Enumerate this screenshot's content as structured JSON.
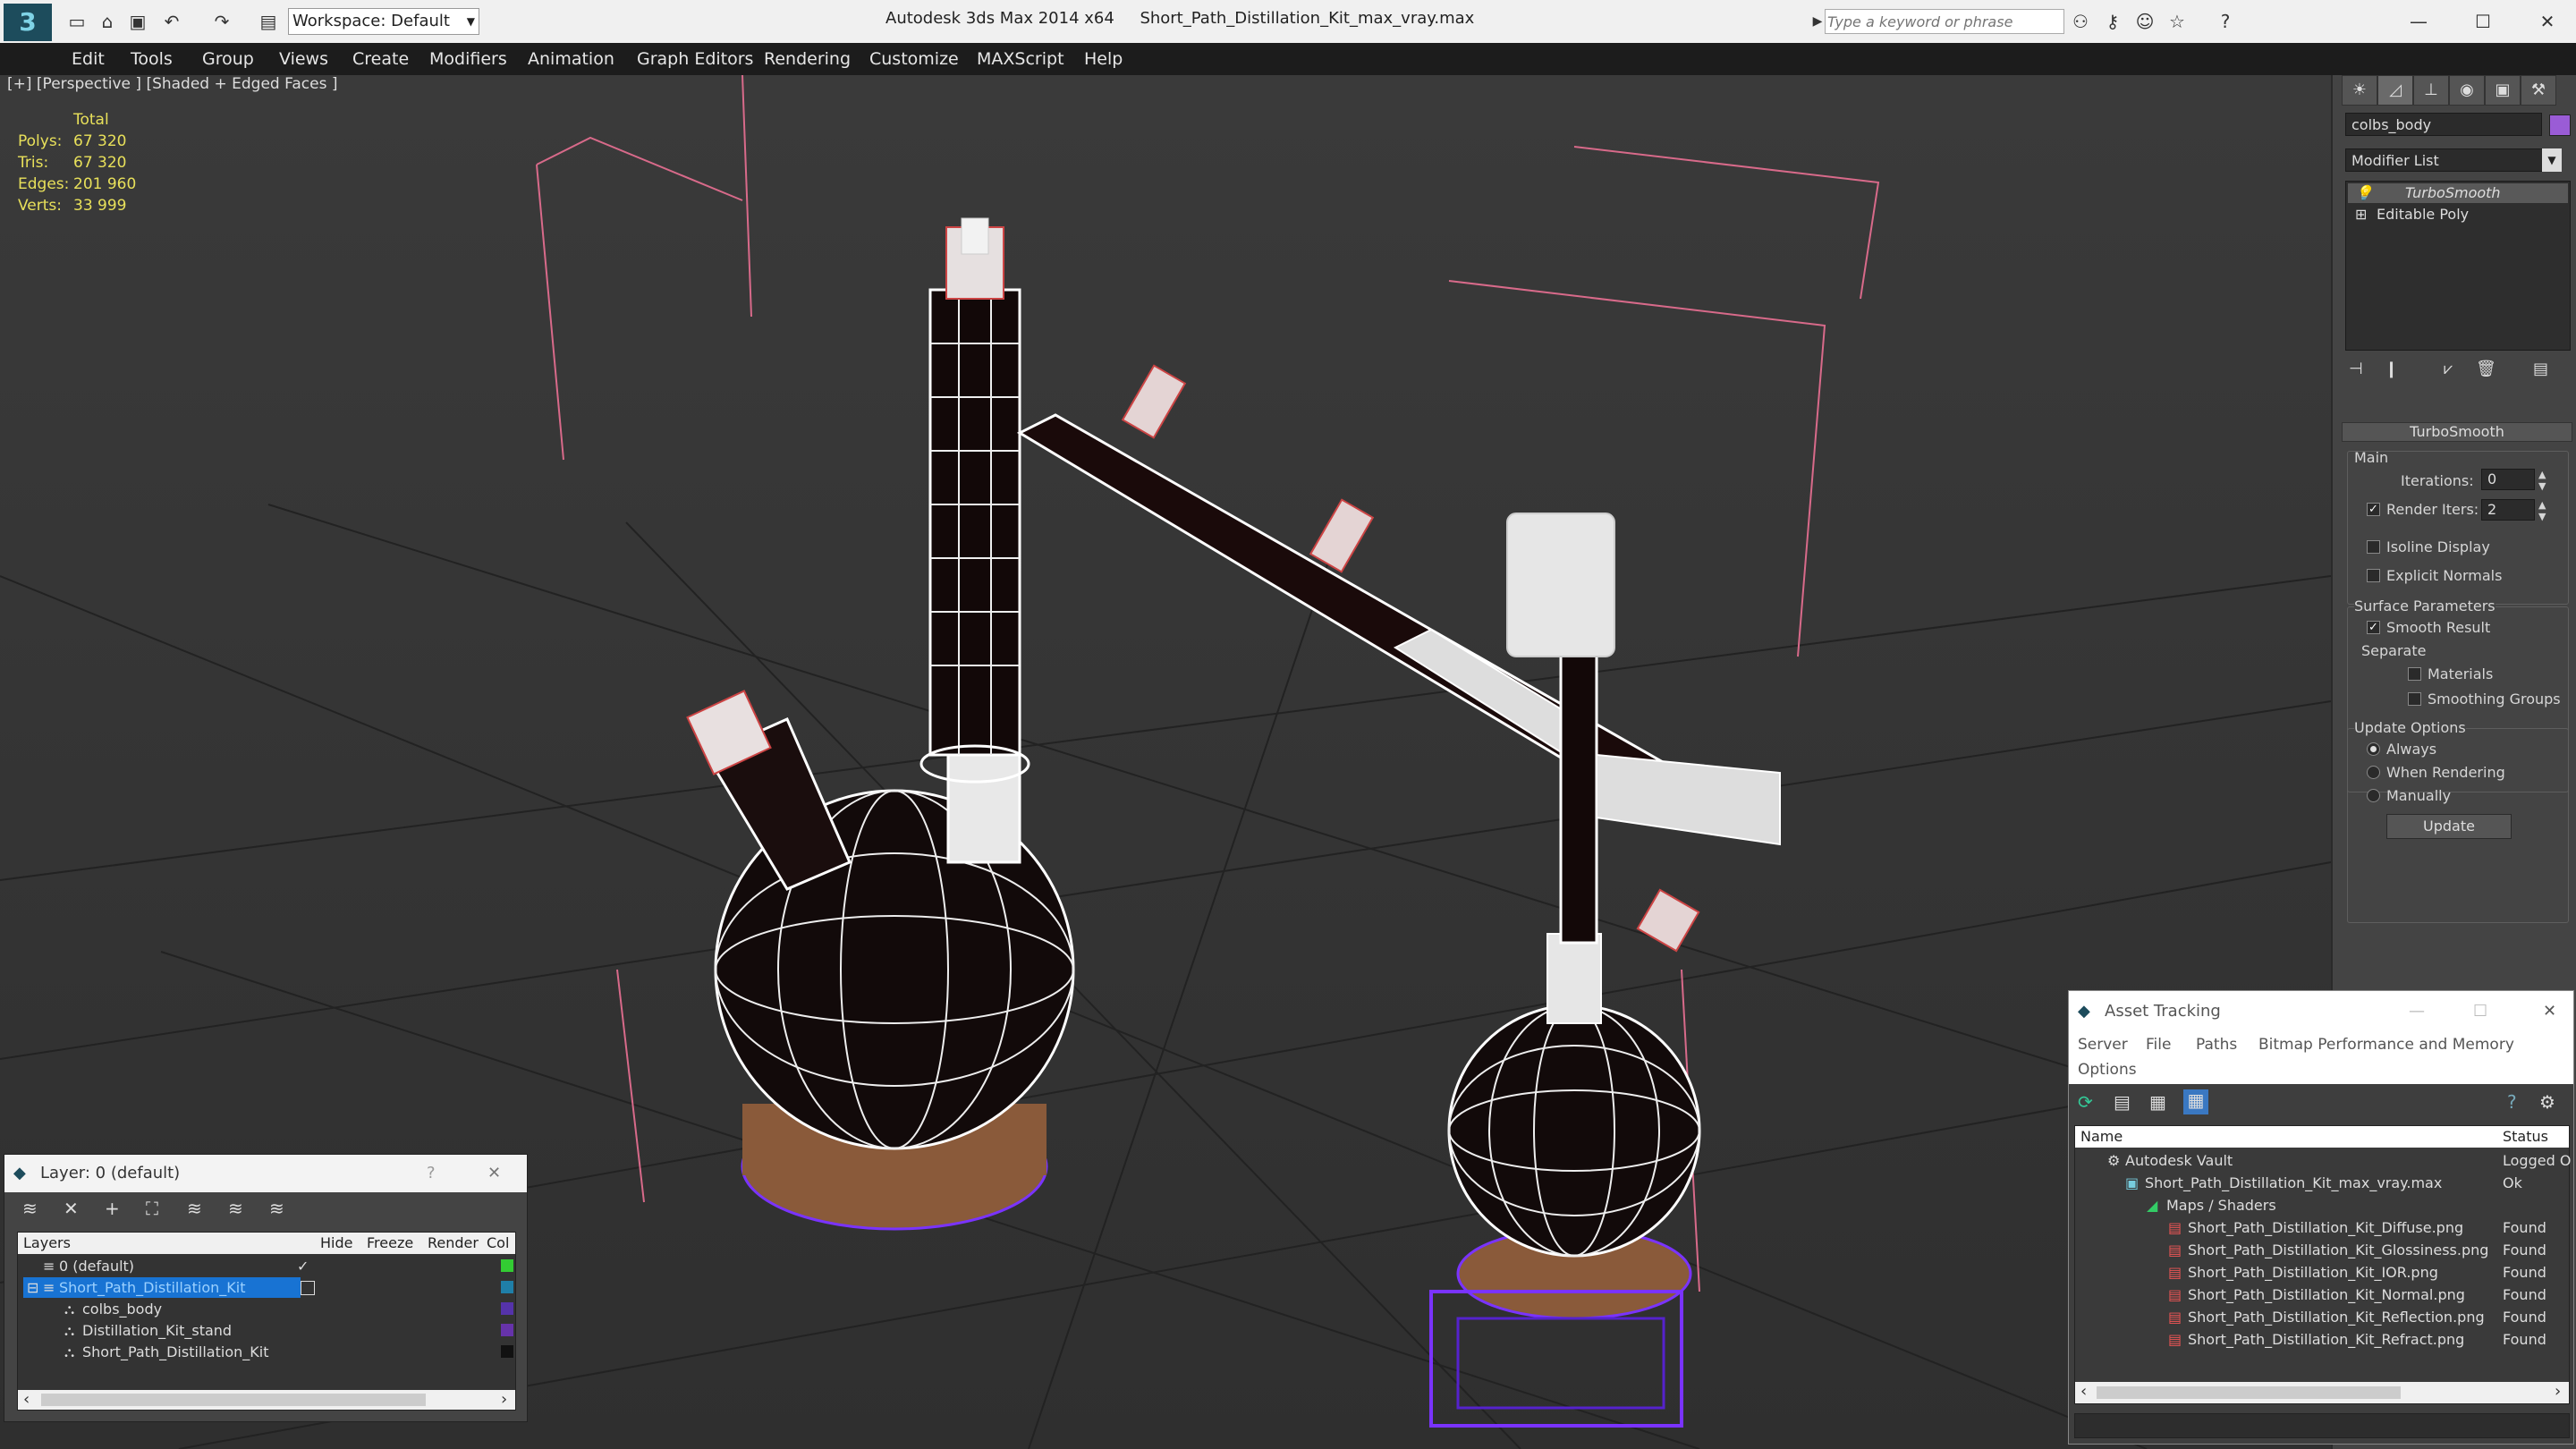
{
  "app": {
    "title": "Autodesk 3ds Max  2014 x64",
    "file": "Short_Path_Distillation_Kit_max_vray.max",
    "workspace": "Workspace: Default",
    "search_placeholder": "Type a keyword or phrase"
  },
  "menu": [
    "Edit",
    "Tools",
    "Group",
    "Views",
    "Create",
    "Modifiers",
    "Animation",
    "Graph Editors",
    "Rendering",
    "Customize",
    "MAXScript",
    "Help"
  ],
  "viewport": {
    "label": "[+] [Perspective ] [Shaded + Edged Faces ]",
    "stats_header": "Total",
    "stats": [
      {
        "label": "Polys:",
        "value": "67 320"
      },
      {
        "label": "Tris:",
        "value": "67 320"
      },
      {
        "label": "Edges:",
        "value": "201 960"
      },
      {
        "label": "Verts:",
        "value": "33 999"
      }
    ]
  },
  "command_panel": {
    "object_name": "colbs_body",
    "object_color": "#9a5cd6",
    "modifier_list": "Modifier List",
    "stack": [
      "TurboSmooth",
      "Editable Poly"
    ],
    "rollout_title": "TurboSmooth",
    "main_label": "Main",
    "iterations_label": "Iterations:",
    "iterations_value": "0",
    "render_iters_label": "Render Iters:",
    "render_iters_value": "2",
    "isoline": "Isoline Display",
    "explicit_normals": "Explicit Normals",
    "surface_params": "Surface Parameters",
    "smooth_result": "Smooth Result",
    "separate": "Separate",
    "materials": "Materials",
    "smoothing_groups": "Smoothing Groups",
    "update_options": "Update Options",
    "always": "Always",
    "when_rendering": "When Rendering",
    "manually": "Manually",
    "update_btn": "Update"
  },
  "layer_dialog": {
    "title": "Layer: 0 (default)",
    "help": "?",
    "columns": [
      "Layers",
      "Hide",
      "Freeze",
      "Render",
      "Col"
    ],
    "rows": [
      {
        "name": "0 (default)",
        "color": "#33cc33"
      },
      {
        "name": "Short_Path_Distillation_Kit",
        "color": "#1f7fa8"
      },
      {
        "name": "colbs_body",
        "color": "#5533aa"
      },
      {
        "name": "Distillation_Kit_stand",
        "color": "#6633aa"
      },
      {
        "name": "Short_Path_Distillation_Kit",
        "color": "#111111"
      }
    ]
  },
  "asset_dialog": {
    "title": "Asset Tracking",
    "menu": [
      "Server",
      "File",
      "Paths",
      "Bitmap Performance and Memory",
      "Options"
    ],
    "col_name": "Name",
    "col_status": "Status",
    "rows": [
      {
        "name": "Autodesk Vault",
        "status": "Logged O"
      },
      {
        "name": "Short_Path_Distillation_Kit_max_vray.max",
        "status": "Ok"
      },
      {
        "name": "Maps / Shaders",
        "status": ""
      },
      {
        "name": "Short_Path_Distillation_Kit_Diffuse.png",
        "status": "Found"
      },
      {
        "name": "Short_Path_Distillation_Kit_Glossiness.png",
        "status": "Found"
      },
      {
        "name": "Short_Path_Distillation_Kit_IOR.png",
        "status": "Found"
      },
      {
        "name": "Short_Path_Distillation_Kit_Normal.png",
        "status": "Found"
      },
      {
        "name": "Short_Path_Distillation_Kit_Reflection.png",
        "status": "Found"
      },
      {
        "name": "Short_Path_Distillation_Kit_Refract.png",
        "status": "Found"
      }
    ]
  }
}
